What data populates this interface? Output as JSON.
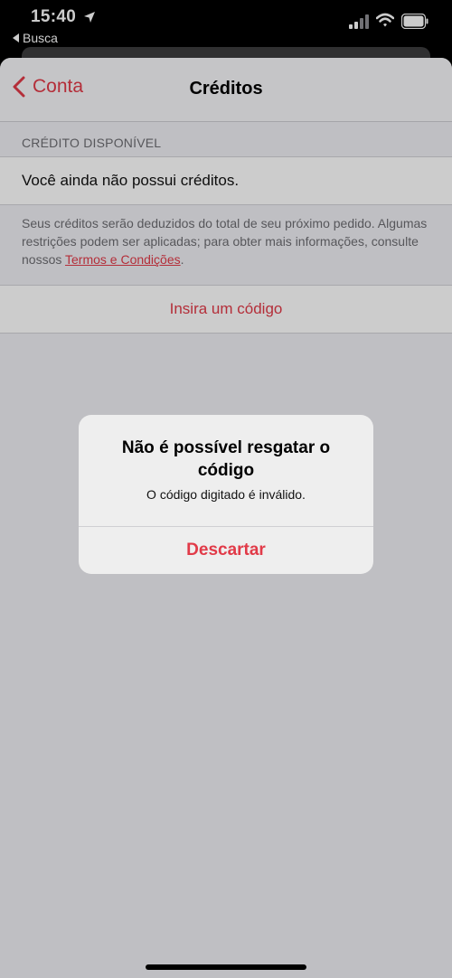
{
  "status_bar": {
    "time": "15:40",
    "back_app_label": "Busca",
    "icons": [
      "location-arrow-icon",
      "signal-icon",
      "wifi-icon",
      "battery-icon"
    ]
  },
  "nav": {
    "back_label": "Conta",
    "title": "Créditos"
  },
  "credits": {
    "section_header": "CRÉDITO DISPONÍVEL",
    "balance_text": "Você ainda não possui créditos.",
    "footnote_text": "Seus créditos serão deduzidos do total de seu próximo pedido. Algumas restrições podem ser aplicadas; para obter mais informações, consulte nossos ",
    "footnote_link": "Termos e Condições",
    "footnote_end": ".",
    "enter_code_label": "Insira um código"
  },
  "alert": {
    "title": "Não é possível resgatar o código",
    "message": "O código digitado é inválido.",
    "button_label": "Descartar"
  },
  "colors": {
    "accent": "#e13a48",
    "background": "#efeff4",
    "alert_background": "#eeeeee"
  }
}
